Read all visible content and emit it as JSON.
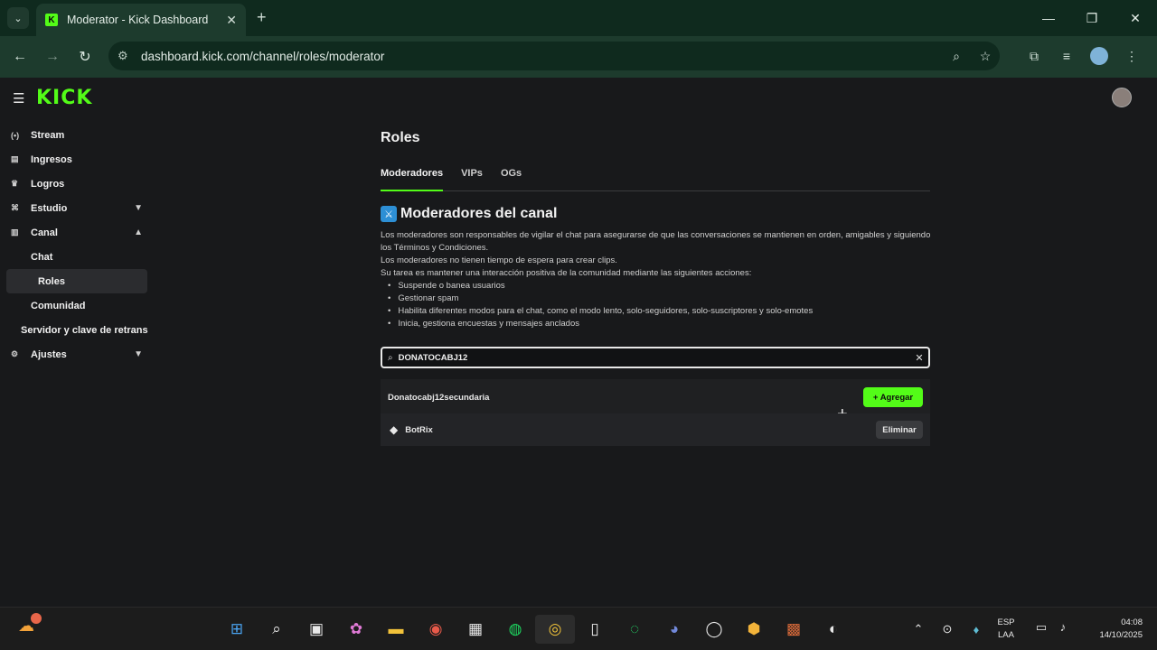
{
  "browser": {
    "tab_title": "Moderator - Kick Dashboard",
    "url": "dashboard.kick.com/channel/roles/moderator",
    "accent": "#53fc18"
  },
  "header": {
    "logo": "KICK"
  },
  "sidebar": {
    "items": [
      {
        "label": "Stream",
        "icon": "stream-icon"
      },
      {
        "label": "Ingresos",
        "icon": "revenue-icon"
      },
      {
        "label": "Logros",
        "icon": "trophy-icon"
      },
      {
        "label": "Estudio",
        "icon": "studio-icon"
      },
      {
        "label": "Canal",
        "icon": "channel-icon"
      },
      {
        "label": "Chat"
      },
      {
        "label": "Roles"
      },
      {
        "label": "Comunidad"
      },
      {
        "label": "Servidor y clave de retrans"
      },
      {
        "label": "Ajustes",
        "icon": "settings-icon"
      }
    ]
  },
  "main": {
    "title": "Roles",
    "tabs": [
      "Moderadores",
      "VIPs",
      "OGs"
    ],
    "section_title": "Moderadores del canal",
    "desc": [
      "Los moderadores son responsables de vigilar el chat para asegurarse de que las conversaciones se mantienen en orden, amigables y siguiendo los Términos y Condiciones.",
      "Los moderadores no tienen tiempo de espera para crear clips.",
      "Su tarea es mantener una interacción positiva de la comunidad mediante las siguientes acciones:"
    ],
    "bullets": [
      "Suspende o banea usuarios",
      "Gestionar spam",
      "Habilita diferentes modos para el chat, como el modo lento, solo-seguidores, solo-suscriptores y solo-emotes",
      "Inicia, gestiona encuestas y mensajes anclados"
    ],
    "search_value": "DONATOCABJ12",
    "search_result": "Donatocabj12secundaria",
    "add_label": "+ Agregar",
    "moderator": "BotRix",
    "remove_label": "Eliminar"
  },
  "taskbar": {
    "lang": [
      "ESP",
      "LAA"
    ],
    "time": "04:08",
    "date": "14/10/2025"
  }
}
